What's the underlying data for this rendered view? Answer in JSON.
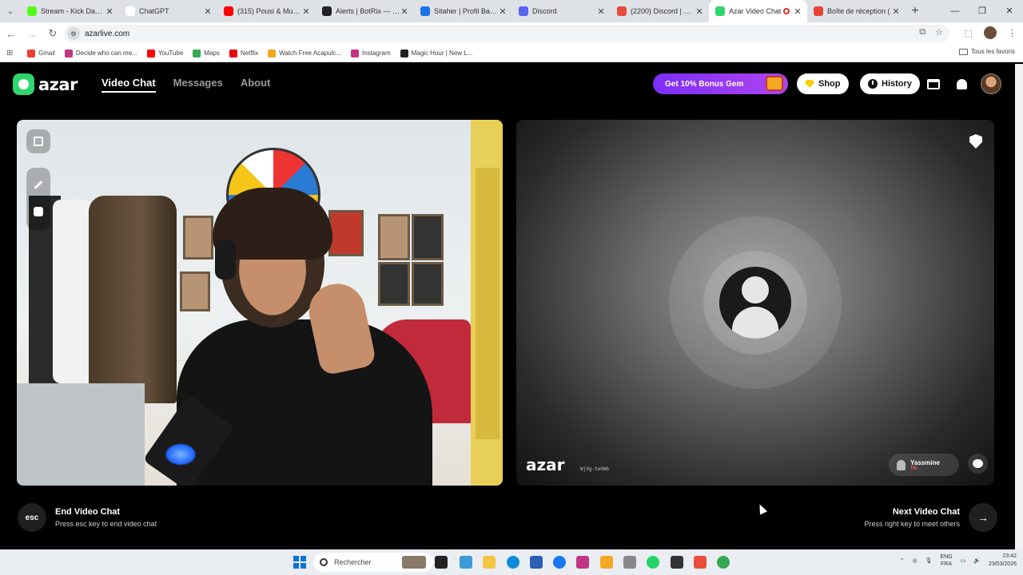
{
  "browser": {
    "tabs": [
      {
        "title": "Stream - Kick Dashbo",
        "color": "#53fc18"
      },
      {
        "title": "ChatGPT",
        "color": "#ffffff"
      },
      {
        "title": "(315) Pousi & Muslim",
        "color": "#ff0000"
      },
      {
        "title": "Alerts | BotRix — Cli",
        "color": "#222222"
      },
      {
        "title": "Sitaher | Profil Bakch",
        "color": "#1a73e8"
      },
      {
        "title": "Discord",
        "color": "#5865f2"
      },
      {
        "title": "(2200) Discord | Frier",
        "color": "#e84c3d"
      },
      {
        "title": "Azar Video Chat",
        "color": "#2fd66d"
      },
      {
        "title": "Boîte de réception (",
        "color": "#ea4335"
      }
    ],
    "active_tab_index": 7,
    "new_tab": "+",
    "url": "azarlive.com",
    "bookmarks": [
      {
        "label": "Gmail",
        "color": "#ea4335"
      },
      {
        "label": "Decide who can me...",
        "color": "#c13584"
      },
      {
        "label": "YouTube",
        "color": "#ff0000"
      },
      {
        "label": "Maps",
        "color": "#34a853"
      },
      {
        "label": "Netflix",
        "color": "#e50914"
      },
      {
        "label": "Watch Free Acapulc...",
        "color": "#f5a623"
      },
      {
        "label": "Instagram",
        "color": "#c13584"
      },
      {
        "label": "Magic Hour | New L...",
        "color": "#222222"
      }
    ],
    "all_bookmarks": "Tous les favoris"
  },
  "app": {
    "logo": "azar",
    "nav": [
      {
        "label": "Video Chat",
        "active": true
      },
      {
        "label": "Messages",
        "active": false
      },
      {
        "label": "About",
        "active": false
      }
    ],
    "promo": "Get 10% Bonus Gem",
    "shop": "Shop",
    "history": "History",
    "accent": "#2fd66d",
    "promo_color": "#8a34f2"
  },
  "partner": {
    "watermark": "azar",
    "watermark_id": "Wj9g-tw0Wb",
    "name": "Yassmine",
    "country": "TN"
  },
  "controls": {
    "esc_key": "esc",
    "end_title": "End Video Chat",
    "end_hint": "Press esc key to end video chat",
    "next_title": "Next Video Chat",
    "next_hint": "Press right key to meet others",
    "next_arrow": "→"
  },
  "taskbar": {
    "search_placeholder": "Rechercher",
    "lang_top": "ENG",
    "lang_bottom": "FRA",
    "time": "23:42",
    "date": "23/03/2026"
  }
}
